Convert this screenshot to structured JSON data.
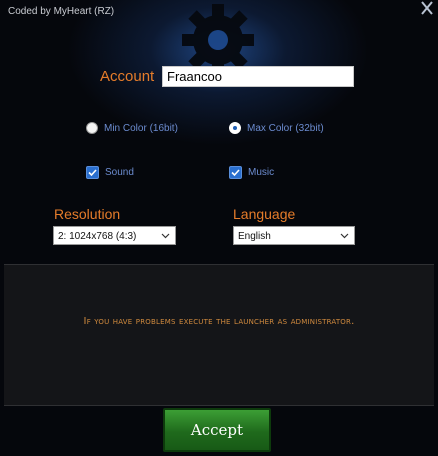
{
  "window": {
    "title": "Coded by MyHeart (RZ)"
  },
  "account": {
    "label": "Account",
    "value": "Fraancoo"
  },
  "color_mode": {
    "options": [
      {
        "label": "Min Color (16bit)",
        "selected": false
      },
      {
        "label": "Max Color (32bit)",
        "selected": true
      }
    ]
  },
  "audio": {
    "sound": {
      "label": "Sound",
      "checked": true
    },
    "music": {
      "label": "Music",
      "checked": true
    }
  },
  "resolution": {
    "label": "Resolution",
    "selected": "2: 1024x768 (4:3)"
  },
  "language": {
    "label": "Language",
    "selected": "English"
  },
  "notice": "If you have problems execute the launcher as administrator.",
  "accept_label": "Accept",
  "colors": {
    "accent_orange": "#e57c2a",
    "option_blue": "#6c8cd0",
    "accept_green": "#2a8a25"
  }
}
